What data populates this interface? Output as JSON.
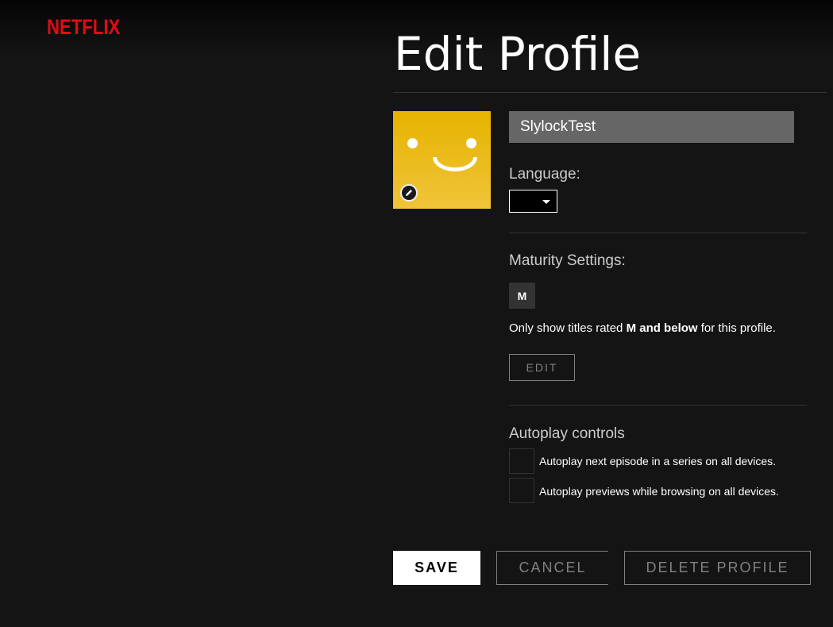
{
  "header": {
    "logo_text": "NETFLIX",
    "brand_color": "#e50914"
  },
  "page": {
    "title": "Edit Profile"
  },
  "profile": {
    "name_value": "SlylockTest",
    "avatar_color": "#e6b300",
    "avatar_icon": "smiley-face-icon",
    "avatar_edit_icon": "pencil-icon"
  },
  "language": {
    "label": "Language:",
    "selected": ""
  },
  "maturity": {
    "label": "Maturity Settings:",
    "rating_badge": "M",
    "desc_prefix": "Only show titles rated ",
    "desc_bold": "M and below",
    "desc_suffix": " for this profile.",
    "edit_label": "EDIT"
  },
  "autoplay": {
    "label": "Autoplay controls",
    "options": [
      {
        "label": "Autoplay next episode in a series on all devices.",
        "checked": false
      },
      {
        "label": "Autoplay previews while browsing on all devices.",
        "checked": false
      }
    ]
  },
  "actions": {
    "save_label": "SAVE",
    "cancel_label": "CANCEL",
    "delete_label": "DELETE PROFILE"
  }
}
